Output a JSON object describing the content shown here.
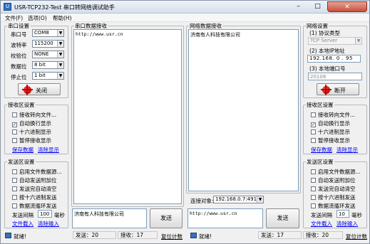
{
  "window": {
    "title": "USR-TCP232-Test 串口转网络调试助手",
    "minimize_glyph": "–",
    "maximize_glyph": "□",
    "close_glyph": "✕"
  },
  "menu": [
    "文件(F)",
    "选项(O)",
    "帮助(H)"
  ],
  "serial_settings": {
    "title": "串口设置",
    "port_label": "串口号",
    "port_value": "COM8",
    "baud_label": "波特率",
    "baud_value": "115200",
    "parity_label": "校验位",
    "parity_value": "NONE",
    "databits_label": "数据位",
    "databits_value": "8 bit",
    "stopbits_label": "停止位",
    "stopbits_value": "1 bit",
    "close_button": "关闭"
  },
  "serial_recv": {
    "title": "串口数据接收",
    "content": "http://www.usr.cn"
  },
  "net_recv": {
    "title": "网络数据接收",
    "content": "济南有人科技有限公司"
  },
  "net_settings": {
    "title": "网络设置",
    "protocol_label": "(1) 协议类型",
    "protocol_value": "TCP Server",
    "host_label": "(2) 本地IP地址",
    "host_value": "192.168. 0 . 95",
    "port_label": "(3) 本地端口号",
    "port_value": "20108",
    "open_button": "断开"
  },
  "left_recv_settings": {
    "title": "接收区设置",
    "options": [
      "接收转向文件...",
      "自动换行显示",
      "十六进制显示",
      "暂停接收显示"
    ],
    "checked": [
      false,
      true,
      false,
      false
    ],
    "save_link": "保存数据",
    "clear_link": "清除显示"
  },
  "left_send_settings": {
    "title": "发送区设置",
    "options": [
      "启用文件数据源...",
      "自动发送附加位",
      "发送完自动清空",
      "按十六进制发送",
      "数据流循环发送"
    ],
    "checked": [
      false,
      false,
      false,
      false,
      false
    ],
    "interval_label": "发送间隔",
    "interval_value": "100",
    "interval_unit": "毫秒",
    "file_link": "文件载入",
    "clear_link": "清除输入"
  },
  "right_recv_settings": {
    "title": "接收区设置",
    "options": [
      "接收转向文件...",
      "自动换行显示",
      "十六进制显示",
      "暂停接收显示"
    ],
    "checked": [
      false,
      true,
      false,
      false
    ],
    "save_link": "保存数据",
    "clear_link": "清除显示"
  },
  "right_send_settings": {
    "title": "发送区设置",
    "options": [
      "启用文件数据源...",
      "自动发送附加位",
      "发送完自动清空",
      "按十六进制发送",
      "数据流循环发送"
    ],
    "checked": [
      false,
      false,
      false,
      false,
      false
    ],
    "interval_label": "发送间隔",
    "interval_value": "10",
    "interval_unit": "毫秒",
    "file_link": "文件载入",
    "clear_link": "清除输入"
  },
  "connection": {
    "label": "连接对象:",
    "value": "192.168.0.7:49154"
  },
  "serial_send": {
    "content": "济南有人科技有限公司",
    "button": "发送"
  },
  "net_send": {
    "content": "http://www.usr.cn",
    "button": "发送"
  },
  "status_left": {
    "ready": "就绪!",
    "sent": "发送：20",
    "recv": "接收：17",
    "reset": "复位计数"
  },
  "status_right": {
    "ready": "就绪!",
    "sent": "发送：17",
    "recv": "接收：20",
    "reset": "复位计数"
  },
  "check_glyph": "✓"
}
